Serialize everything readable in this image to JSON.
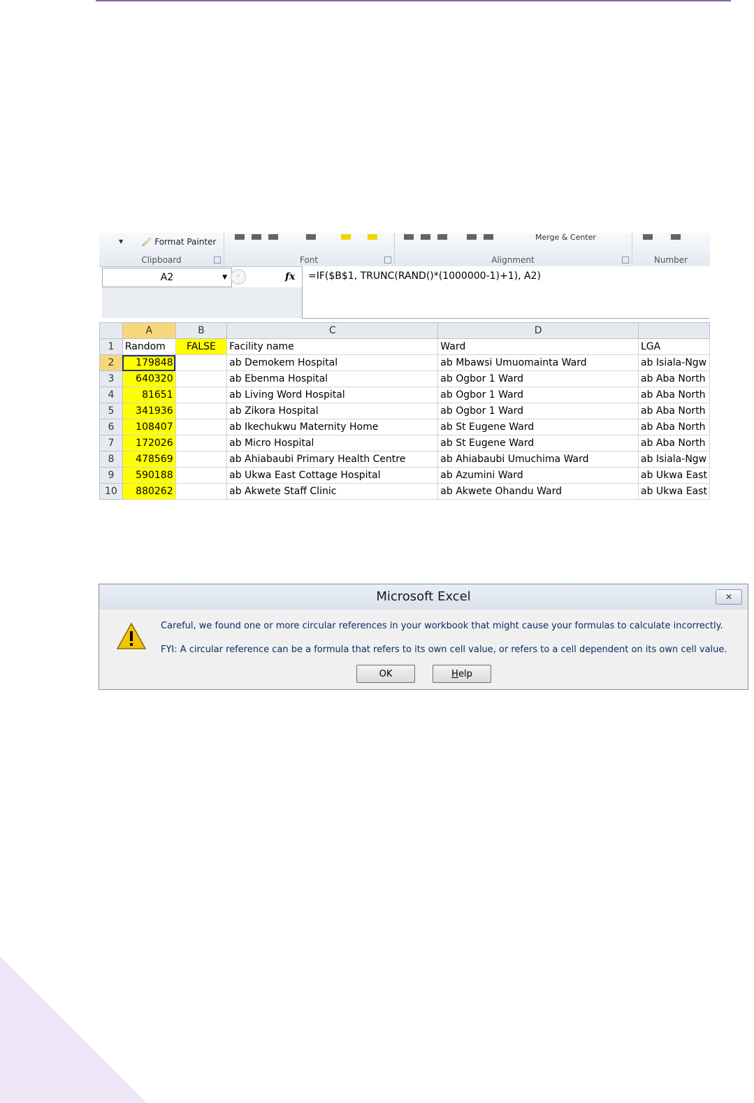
{
  "ribbon": {
    "format_painter": "Format Painter",
    "merge_label": "Merge & Center",
    "groups": [
      "Clipboard",
      "Font",
      "Alignment",
      "Number"
    ]
  },
  "formula_bar": {
    "name_box": "A2",
    "fx": "fx",
    "formula": "=IF($B$1, TRUNC(RAND()*(1000000-1)+1), A2)"
  },
  "sheet": {
    "columns": [
      "A",
      "B",
      "C",
      "D",
      ""
    ],
    "header_row": {
      "num": "1",
      "a": "Random",
      "b": "FALSE",
      "c": "Facility name",
      "d": "Ward",
      "e": "LGA"
    },
    "rows": [
      {
        "num": "2",
        "a": "179848",
        "c": "ab Demokem Hospital",
        "d": "ab Mbawsi Umuomainta Ward",
        "e": "ab Isiala-Ngw"
      },
      {
        "num": "3",
        "a": "640320",
        "c": "ab Ebenma Hospital",
        "d": "ab Ogbor 1 Ward",
        "e": "ab Aba North"
      },
      {
        "num": "4",
        "a": "81651",
        "c": "ab Living Word Hospital",
        "d": "ab Ogbor 1 Ward",
        "e": "ab Aba North"
      },
      {
        "num": "5",
        "a": "341936",
        "c": "ab Zikora Hospital",
        "d": "ab Ogbor 1 Ward",
        "e": "ab Aba North"
      },
      {
        "num": "6",
        "a": "108407",
        "c": "ab Ikechukwu Maternity Home",
        "d": "ab St Eugene Ward",
        "e": "ab Aba North"
      },
      {
        "num": "7",
        "a": "172026",
        "c": "ab Micro Hospital",
        "d": "ab St Eugene Ward",
        "e": "ab Aba North"
      },
      {
        "num": "8",
        "a": "478569",
        "c": "ab Ahiabaubi Primary Health Centre",
        "d": "ab Ahiabaubi Umuchima Ward",
        "e": "ab Isiala-Ngw"
      },
      {
        "num": "9",
        "a": "590188",
        "c": "ab Ukwa East Cottage Hospital",
        "d": "ab Azumini Ward",
        "e": "ab Ukwa East"
      },
      {
        "num": "10",
        "a": "880262",
        "c": "ab Akwete Staff Clinic",
        "d": "ab Akwete Ohandu Ward",
        "e": "ab Ukwa East"
      }
    ]
  },
  "dialog": {
    "title": "Microsoft Excel",
    "message_1": "Careful, we found one or more circular references in your workbook that might cause your formulas to calculate incorrectly.",
    "message_2": "FYI: A circular reference can be a formula that refers to its own cell value, or refers to a cell dependent on its own cell value.",
    "ok_label": "OK",
    "help_label": "Help"
  },
  "colors": {
    "highlight": "#ffff00",
    "accent": "#8a62a8",
    "selection": "#1f2c8f"
  }
}
